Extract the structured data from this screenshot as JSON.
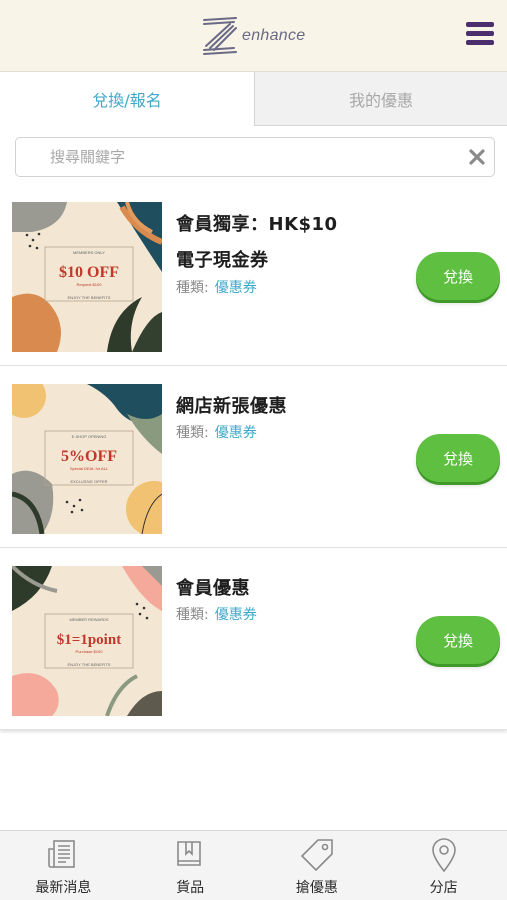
{
  "header": {
    "logo_text": "enhance",
    "menu_icon": "hamburger-menu-icon",
    "accent_color": "#4b2e6e"
  },
  "tabs": [
    {
      "label": "兌換/報名",
      "active": true
    },
    {
      "label": "我的優惠",
      "active": false
    }
  ],
  "search": {
    "placeholder": "搜尋關鍵字",
    "value": ""
  },
  "category_label": "種類:",
  "coupons": [
    {
      "title_line1": "會員獨享：HK$10",
      "title_line2": "電子現金券",
      "category": "優惠券",
      "button": "兌換",
      "image": {
        "top_text": "MEMBERS ONLY",
        "main_text": "$10 OFF",
        "sub_text": "Request $100",
        "bottom_text": "ENJOY THE BENEFITS"
      }
    },
    {
      "title_line1": "網店新張優惠",
      "title_line2": "",
      "category": "優惠券",
      "button": "兌換",
      "image": {
        "top_text": "E-SHOP OPENING",
        "main_text": "5%OFF",
        "sub_text": "Special DEAL for ALL",
        "bottom_text": "EXCLUSIVE OFFER"
      }
    },
    {
      "title_line1": "會員優惠",
      "title_line2": "",
      "category": "優惠券",
      "button": "兌換",
      "image": {
        "top_text": "MEMBER REWARDS",
        "main_text": "$1=1point",
        "sub_text": "Purchase $100",
        "bottom_text": "ENJOY THE BENEFITS"
      }
    }
  ],
  "bottom_nav": [
    {
      "label": "最新消息",
      "icon": "newspaper-icon"
    },
    {
      "label": "貨品",
      "icon": "book-icon"
    },
    {
      "label": "搶優惠",
      "icon": "tag-icon"
    },
    {
      "label": "分店",
      "icon": "location-pin-icon"
    }
  ],
  "colors": {
    "header_bg": "#f8f4e7",
    "tab_active_text": "#3fa9c9",
    "button_green": "#5fbf40",
    "category_blue": "#3fa9c9"
  }
}
